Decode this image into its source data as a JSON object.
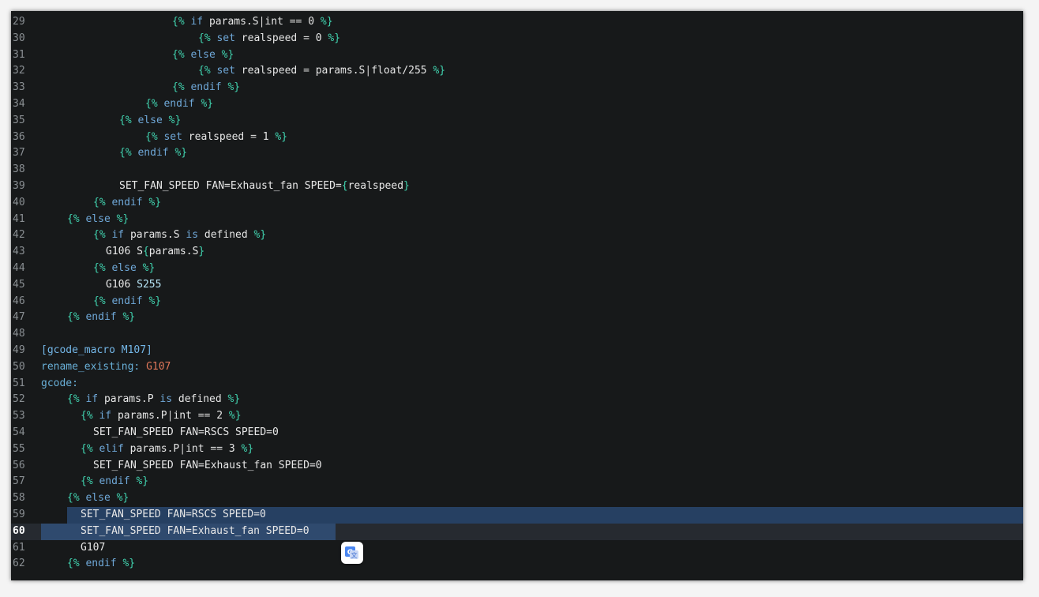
{
  "lines": [
    {
      "n": "29",
      "tokens": [
        [
          "t-brace",
          "{%"
        ],
        [
          "t-kw",
          " if "
        ],
        [
          "t-id",
          "params.S"
        ],
        [
          "t-op",
          "|"
        ],
        [
          "t-id",
          "int"
        ],
        [
          "t-op",
          " == "
        ],
        [
          "t-num",
          "0"
        ],
        [
          "t-brace",
          " %}"
        ]
      ]
    },
    {
      "n": "30",
      "tokens": [
        [
          "t-brace",
          "{%"
        ],
        [
          "t-kw",
          " set "
        ],
        [
          "t-id",
          "realspeed"
        ],
        [
          "t-op",
          " = "
        ],
        [
          "t-num",
          "0"
        ],
        [
          "t-brace",
          " %}"
        ]
      ]
    },
    {
      "n": "31",
      "tokens": [
        [
          "t-brace",
          "{%"
        ],
        [
          "t-kw",
          " else "
        ],
        [
          "t-brace",
          "%}"
        ]
      ]
    },
    {
      "n": "32",
      "tokens": [
        [
          "t-brace",
          "{%"
        ],
        [
          "t-kw",
          " set "
        ],
        [
          "t-id",
          "realspeed"
        ],
        [
          "t-op",
          " = "
        ],
        [
          "t-id",
          "params.S"
        ],
        [
          "t-op",
          "|"
        ],
        [
          "t-id",
          "float/255"
        ],
        [
          "t-brace",
          " %}"
        ]
      ]
    },
    {
      "n": "33",
      "tokens": [
        [
          "t-brace",
          "{%"
        ],
        [
          "t-kw",
          " endif "
        ],
        [
          "t-brace",
          "%}"
        ]
      ]
    },
    {
      "n": "34",
      "tokens": [
        [
          "t-brace",
          "{%"
        ],
        [
          "t-kw",
          " endif "
        ],
        [
          "t-brace",
          "%}"
        ]
      ]
    },
    {
      "n": "35",
      "tokens": [
        [
          "t-brace",
          "{%"
        ],
        [
          "t-kw",
          " else "
        ],
        [
          "t-brace",
          "%}"
        ]
      ]
    },
    {
      "n": "36",
      "tokens": [
        [
          "t-brace",
          "{%"
        ],
        [
          "t-kw",
          " set "
        ],
        [
          "t-id",
          "realspeed"
        ],
        [
          "t-op",
          " = "
        ],
        [
          "t-num",
          "1"
        ],
        [
          "t-brace",
          " %}"
        ]
      ]
    },
    {
      "n": "37",
      "tokens": [
        [
          "t-brace",
          "{%"
        ],
        [
          "t-kw",
          " endif "
        ],
        [
          "t-brace",
          "%}"
        ]
      ]
    },
    {
      "n": "38",
      "tokens": []
    },
    {
      "n": "39",
      "tokens": [
        [
          "t-text",
          "SET_FAN_SPEED FAN=Exhaust_fan SPEED="
        ],
        [
          "t-brace",
          "{"
        ],
        [
          "t-text",
          "realspeed"
        ],
        [
          "t-brace",
          "}"
        ]
      ]
    },
    {
      "n": "40",
      "tokens": [
        [
          "t-brace",
          "{%"
        ],
        [
          "t-kw",
          " endif "
        ],
        [
          "t-brace",
          "%}"
        ]
      ]
    },
    {
      "n": "41",
      "tokens": [
        [
          "t-brace",
          "{%"
        ],
        [
          "t-kw",
          " else "
        ],
        [
          "t-brace",
          "%}"
        ]
      ]
    },
    {
      "n": "42",
      "tokens": [
        [
          "t-brace",
          "{%"
        ],
        [
          "t-kw",
          " if "
        ],
        [
          "t-id",
          "params.S"
        ],
        [
          "t-kw",
          " is "
        ],
        [
          "t-id",
          "defined"
        ],
        [
          "t-brace",
          " %}"
        ]
      ]
    },
    {
      "n": "43",
      "tokens": [
        [
          "t-text",
          "G106 S"
        ],
        [
          "t-brace",
          "{"
        ],
        [
          "t-text",
          "params.S"
        ],
        [
          "t-brace",
          "}"
        ]
      ]
    },
    {
      "n": "44",
      "tokens": [
        [
          "t-brace",
          "{%"
        ],
        [
          "t-kw",
          " else "
        ],
        [
          "t-brace",
          "%}"
        ]
      ]
    },
    {
      "n": "45",
      "tokens": [
        [
          "t-text",
          "G106 "
        ],
        [
          "t-lit",
          "S255"
        ]
      ]
    },
    {
      "n": "46",
      "tokens": [
        [
          "t-brace",
          "{%"
        ],
        [
          "t-kw",
          " endif "
        ],
        [
          "t-brace",
          "%}"
        ]
      ]
    },
    {
      "n": "47",
      "tokens": [
        [
          "t-brace",
          "{%"
        ],
        [
          "t-kw",
          " endif "
        ],
        [
          "t-brace",
          "%}"
        ]
      ]
    },
    {
      "n": "48",
      "tokens": []
    },
    {
      "n": "49",
      "tokens": [
        [
          "t-sec",
          "[gcode_macro M107]"
        ]
      ]
    },
    {
      "n": "50",
      "tokens": [
        [
          "t-key",
          "rename_existing: "
        ],
        [
          "t-val",
          "G107"
        ]
      ]
    },
    {
      "n": "51",
      "tokens": [
        [
          "t-key",
          "gcode:"
        ]
      ]
    },
    {
      "n": "52",
      "tokens": [
        [
          "t-brace",
          "{%"
        ],
        [
          "t-kw",
          " if "
        ],
        [
          "t-id",
          "params.P"
        ],
        [
          "t-kw",
          " is "
        ],
        [
          "t-id",
          "defined"
        ],
        [
          "t-brace",
          " %}"
        ]
      ]
    },
    {
      "n": "53",
      "tokens": [
        [
          "t-brace",
          "{%"
        ],
        [
          "t-kw",
          " if "
        ],
        [
          "t-id",
          "params.P"
        ],
        [
          "t-op",
          "|"
        ],
        [
          "t-id",
          "int"
        ],
        [
          "t-op",
          " == "
        ],
        [
          "t-num",
          "2"
        ],
        [
          "t-brace",
          " %}"
        ]
      ]
    },
    {
      "n": "54",
      "tokens": [
        [
          "t-text",
          "SET_FAN_SPEED FAN=RSCS SPEED=0"
        ]
      ]
    },
    {
      "n": "55",
      "tokens": [
        [
          "t-brace",
          "{%"
        ],
        [
          "t-kw",
          " elif "
        ],
        [
          "t-id",
          "params.P"
        ],
        [
          "t-op",
          "|"
        ],
        [
          "t-id",
          "int"
        ],
        [
          "t-op",
          " == "
        ],
        [
          "t-num",
          "3"
        ],
        [
          "t-brace",
          " %}"
        ]
      ]
    },
    {
      "n": "56",
      "tokens": [
        [
          "t-text",
          "SET_FAN_SPEED FAN=Exhaust_fan SPEED=0"
        ]
      ]
    },
    {
      "n": "57",
      "tokens": [
        [
          "t-brace",
          "{%"
        ],
        [
          "t-kw",
          " endif "
        ],
        [
          "t-brace",
          "%}"
        ]
      ]
    },
    {
      "n": "58",
      "tokens": [
        [
          "t-brace",
          "{%"
        ],
        [
          "t-kw",
          " else "
        ],
        [
          "t-brace",
          "%}"
        ]
      ]
    },
    {
      "n": "59",
      "tokens": [
        [
          "t-text",
          "SET_FAN_SPEED FAN=RSCS SPEED=0"
        ]
      ]
    },
    {
      "n": "60",
      "tokens": [
        [
          "t-text",
          "SET_FAN_SPEED FAN=Exhaust_fan SPEED=0"
        ]
      ]
    },
    {
      "n": "61",
      "tokens": [
        [
          "t-text",
          "G107"
        ]
      ]
    },
    {
      "n": "62",
      "tokens": [
        [
          "t-brace",
          "{%"
        ],
        [
          "t-kw",
          " endif "
        ],
        [
          "t-brace",
          "%}"
        ]
      ]
    }
  ],
  "current_line": "60",
  "translate_icon": "google-translate-icon"
}
